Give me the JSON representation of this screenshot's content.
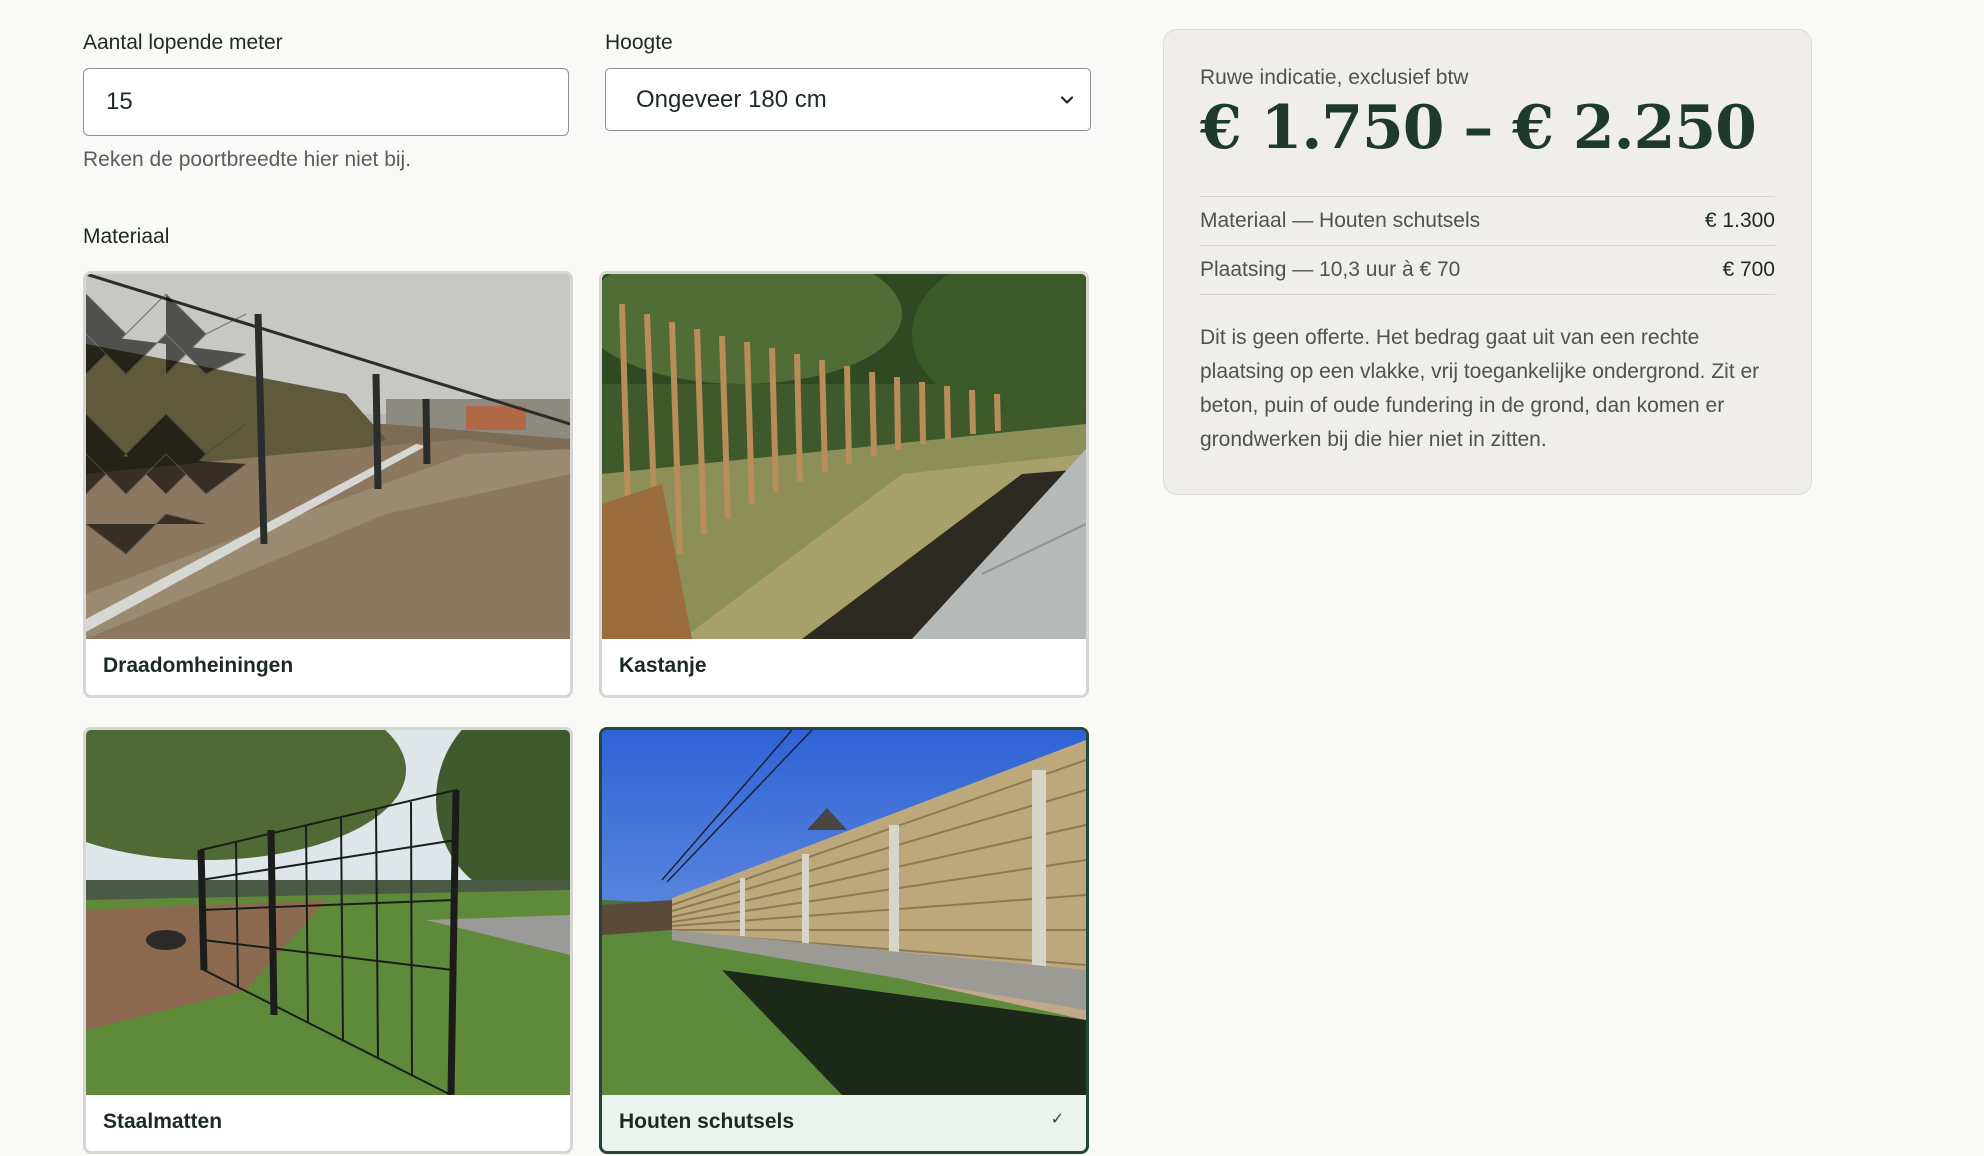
{
  "form": {
    "meters_label": "Aantal lopende meter",
    "meters_value": "15",
    "meters_hint": "Reken de poortbreedte hier niet bij.",
    "height_label": "Hoogte",
    "height_selected": "Ongeveer 180 cm",
    "material_label": "Materiaal"
  },
  "materials": [
    {
      "label": "Draadomheiningen",
      "image": "chain-link fence along a muddy yard",
      "selected": false
    },
    {
      "label": "Kastanje",
      "image": "chestnut stake fence behind ornamental grasses",
      "selected": false
    },
    {
      "label": "Staalmatten",
      "image": "black steel mesh panel fence on a lawn",
      "selected": false
    },
    {
      "label": "Houten schutsels",
      "image": "horizontal wooden panel fence with concrete posts",
      "selected": true
    }
  ],
  "estimate": {
    "caption": "Ruwe indicatie, exclusief btw",
    "range": "€ 1.750 – € 2.250",
    "lines": [
      {
        "label": "Materiaal — Houten schutsels",
        "amount": "€ 1.300"
      },
      {
        "label": "Plaatsing — 10,3 uur à € 70",
        "amount": "€ 700"
      }
    ],
    "note": "Dit is geen offerte. Het bedrag gaat uit van een rechte plaatsing op een vlakke, vrij toegankelijke ondergrond. Zit er beton, puin of oude fundering in de grond, dan komen er grondwerken bij die hier niet in zitten."
  },
  "colors": {
    "accent": "#25473a",
    "selected_bg": "#eaf3ee",
    "page_bg": "#f9f9f7",
    "panel_bg": "#efeeeb"
  }
}
